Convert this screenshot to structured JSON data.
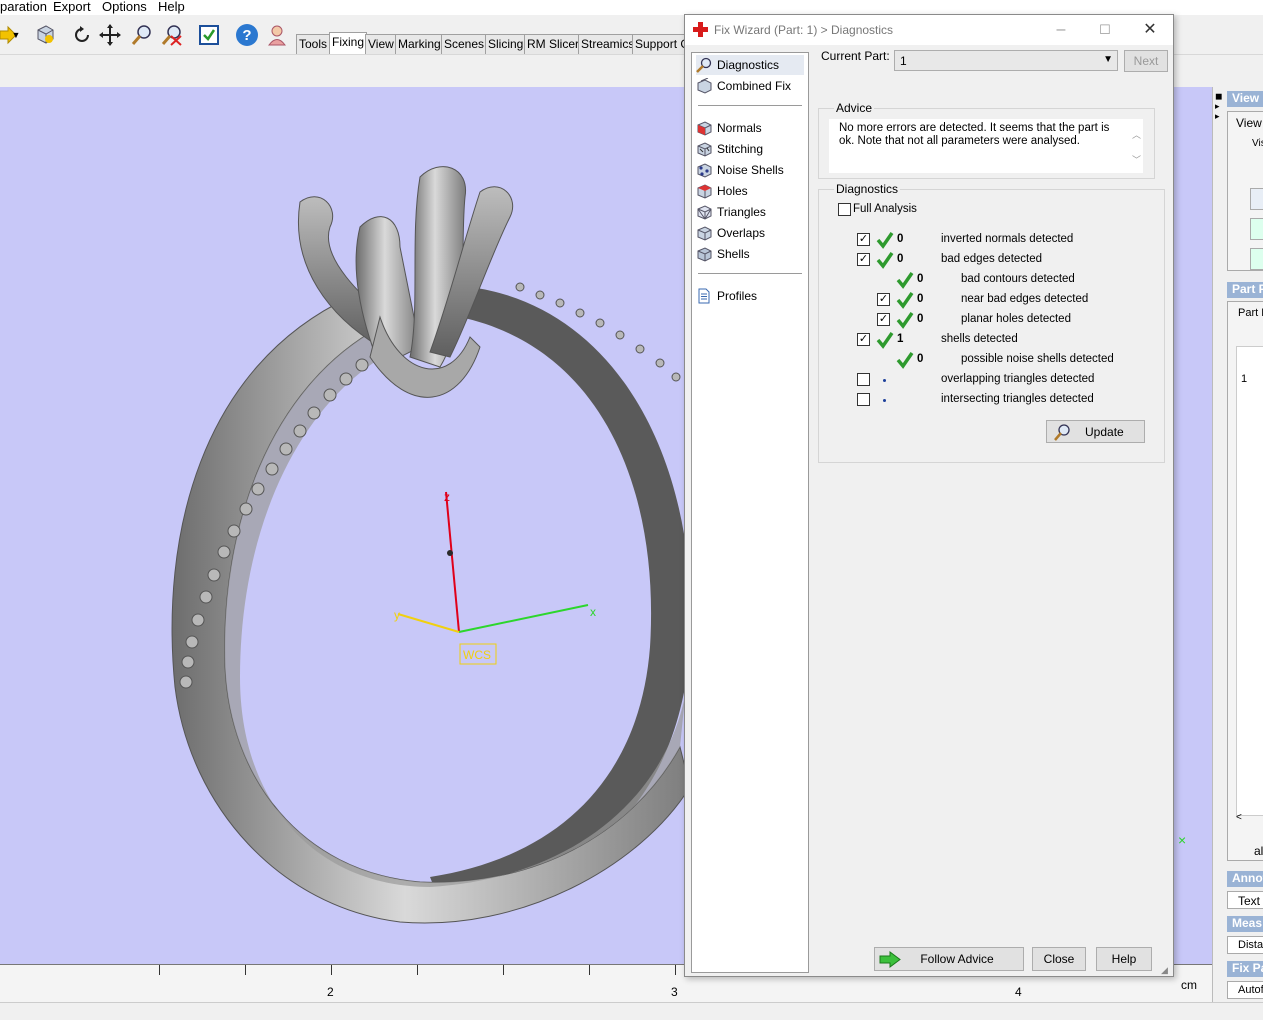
{
  "menu": [
    "paration",
    "Export",
    "Options",
    "Help"
  ],
  "toolbar_icons": [
    "open-arrow-icon",
    "dropdown-icon",
    "part-icon",
    "rotate-icon",
    "pan-icon",
    "zoom-icon",
    "zoom-fit-icon",
    "checklist-icon",
    "help-icon",
    "assistant-icon"
  ],
  "tabs": [
    "Tools",
    "Fixing",
    "View",
    "Marking",
    "Scenes",
    "Slicing",
    "RM Slicer",
    "Streamics",
    "Support G"
  ],
  "active_tab": "Fixing",
  "viewport": {
    "background": "#c8c8f8",
    "axes": {
      "z": "z",
      "y": "y",
      "x": "x",
      "wcs": "WCS"
    },
    "ruler_labels": [
      "2",
      "3",
      "4"
    ],
    "unit": "cm"
  },
  "right_panel": {
    "view_header": "View",
    "view_tab": "View",
    "visu": "Visu",
    "part_header": "Part P",
    "part_list": "Part L",
    "row_number": "1",
    "all_label": "all",
    "annot_header": "Annot",
    "text_label": "Text",
    "meas_header": "Meas",
    "dist_label": "Distar",
    "fixpa_header": "Fix Pa",
    "auto_label": "Autof"
  },
  "dialog": {
    "title": "Fix Wizard (Part: 1) > Diagnostics",
    "nav_top": [
      {
        "label": "Diagnostics",
        "icon": "magnifier-icon",
        "selected": true
      },
      {
        "label": "Combined Fix",
        "icon": "combined-fix-icon",
        "selected": false
      }
    ],
    "nav_mid": [
      {
        "label": "Normals",
        "icon": "normals-cube-icon"
      },
      {
        "label": "Stitching",
        "icon": "stitching-cube-icon"
      },
      {
        "label": "Noise Shells",
        "icon": "noise-shells-icon"
      },
      {
        "label": "Holes",
        "icon": "holes-cube-icon"
      },
      {
        "label": "Triangles",
        "icon": "triangles-cube-icon"
      },
      {
        "label": "Overlaps",
        "icon": "overlaps-cube-icon"
      },
      {
        "label": "Shells",
        "icon": "shells-cube-icon"
      }
    ],
    "nav_bottom": [
      {
        "label": "Profiles",
        "icon": "profiles-document-icon"
      }
    ],
    "current_part_label": "Current Part:",
    "current_part_value": "1",
    "next_label": "Next",
    "advice_title": "Advice",
    "advice_text": "No more errors are detected. It seems that the part is ok. Note that not all parameters were analysed.",
    "diagnostics_title": "Diagnostics",
    "full_analysis_label": "Full Analysis",
    "full_analysis_checked": false,
    "rows": [
      {
        "checkbox": true,
        "checked": true,
        "status": "ok",
        "count": "0",
        "label": "inverted normals detected",
        "indent": 0
      },
      {
        "checkbox": true,
        "checked": true,
        "status": "ok",
        "count": "0",
        "label": "bad edges detected",
        "indent": 0
      },
      {
        "checkbox": false,
        "checked": false,
        "status": "ok",
        "count": "0",
        "label": "bad contours detected",
        "indent": 1
      },
      {
        "checkbox": true,
        "checked": true,
        "status": "ok",
        "count": "0",
        "label": "near bad edges detected",
        "indent": 1
      },
      {
        "checkbox": true,
        "checked": true,
        "status": "ok",
        "count": "0",
        "label": "planar holes detected",
        "indent": 1
      },
      {
        "checkbox": true,
        "checked": true,
        "status": "ok",
        "count": "1",
        "label": "shells detected",
        "indent": 0
      },
      {
        "checkbox": false,
        "checked": false,
        "status": "ok",
        "count": "0",
        "label": "possible noise shells detected",
        "indent": 1
      },
      {
        "checkbox": true,
        "checked": false,
        "status": "none",
        "count": "",
        "label": "overlapping triangles detected",
        "indent": 0
      },
      {
        "checkbox": true,
        "checked": false,
        "status": "none",
        "count": "",
        "label": "intersecting triangles detected",
        "indent": 0
      }
    ],
    "update_label": "Update",
    "follow_advice_label": "Follow Advice",
    "close_label": "Close",
    "help_label": "Help"
  }
}
